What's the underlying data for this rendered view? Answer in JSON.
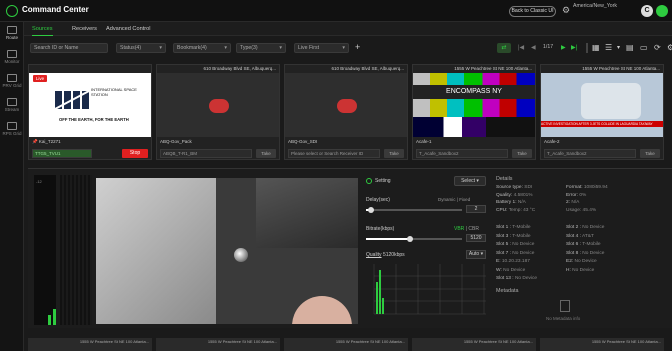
{
  "header": {
    "app_title": "Command Center",
    "back_button": "Back to Classic UI",
    "timezone": "America/New_York",
    "time": "",
    "avatar_letter": "C"
  },
  "nav": [
    {
      "label": "Route"
    },
    {
      "label": "Monitor"
    },
    {
      "label": "PRV Grid"
    },
    {
      "label": "Stream"
    },
    {
      "label": "RPS Grid"
    }
  ],
  "tabs": [
    "Sources",
    "Receivers",
    "Advanced Control"
  ],
  "filters": {
    "search_placeholder": "Search ID or Name",
    "status": "Status(4)",
    "bookmark": "Bookmark(4)",
    "type": "Type(3)",
    "sort": "Live First",
    "pagination": "1/17"
  },
  "tiles": [
    {
      "address": "",
      "name": "Kai_T2271",
      "source": "TTG5_TVU1",
      "action": "Stop",
      "live": "Live",
      "iss_title": "INTERNATIONAL SPACE STATION",
      "iss_sub": "OFF THE EARTH, FOR THE EARTH"
    },
    {
      "address": "610 Broadway Blvd SE, Albuquerq...",
      "name": "ABQ-Gov_Pack",
      "source": "ABQB_T-R1_BM",
      "action": "Take"
    },
    {
      "address": "610 Broadway Blvd SE, Albuquerq...",
      "name": "ABQ-Gov_SDI",
      "source": "Please select or Search Receiver ID",
      "action": "Take"
    },
    {
      "address": "1555 W Peachtree St NE 100 Atlanta...",
      "name": "Acafe-1",
      "source": "T_Acafe_Sandbox2",
      "action": "Take",
      "overlay": "ENCOMPASS NY"
    },
    {
      "address": "1555 W Peachtree St NE 100 Atlanta...",
      "name": "Acafe-2",
      "source": "T_Acafe_Sandbox2",
      "action": "Take",
      "ticker": "ACTIVE INVESTIGATION AFTER 3 JETS COLLIDE IN LAGUARDIA TAXIWAY"
    }
  ],
  "settings": {
    "setting_label": "Setting",
    "select_label": "Select",
    "delay_label": "Delay(sec)",
    "dynamic_label": "Dynamic",
    "fixed_label": "Fixed",
    "delay_value": "2",
    "bitrate_label": "Bitrate(kbps)",
    "vbr": "VBR",
    "cbr": "CBR",
    "bitrate_value": "5120",
    "quality_label": "Quality",
    "quality_value": "5120kbps",
    "auto_label": "Auto"
  },
  "details": {
    "title": "Details",
    "left": [
      {
        "k": "Source type:",
        "v": "SDI"
      },
      {
        "k": "Quality:",
        "v": "4.5801%"
      },
      {
        "k": "Battery 1:",
        "v": "N/A"
      },
      {
        "k": "CPU:",
        "v": "Temp: 43 °C"
      }
    ],
    "right": [
      {
        "k": "Format:",
        "v": "1080i59.94"
      },
      {
        "k": "Error:",
        "v": "0%"
      },
      {
        "k": "2:",
        "v": "N/A"
      },
      {
        "k": "",
        "v": "Usage: 45.4%"
      }
    ],
    "slots_left": [
      {
        "k": "Slot 1 :",
        "v": "T-Mobile"
      },
      {
        "k": "Slot 3 :",
        "v": "T-Mobile"
      },
      {
        "k": "Slot 5 :",
        "v": "No Device"
      },
      {
        "k": "Slot 7 :",
        "v": "No Device"
      },
      {
        "k": "E:",
        "v": "10.20.23.187"
      },
      {
        "k": "W:",
        "v": "No Device"
      },
      {
        "k": "Slot 13 :",
        "v": "No Device"
      }
    ],
    "slots_right": [
      {
        "k": "Slot 2 :",
        "v": "No Device"
      },
      {
        "k": "Slot 4 :",
        "v": "AT&T"
      },
      {
        "k": "Slot 6 :",
        "v": "T-Mobile"
      },
      {
        "k": "Slot 8 :",
        "v": "No Device"
      },
      {
        "k": "E2:",
        "v": "No Device"
      },
      {
        "k": "H:",
        "v": "No Device"
      },
      {
        "k": "",
        "v": ""
      }
    ],
    "metadata_title": "Metadata",
    "metadata_empty": "No Metadata info"
  },
  "bottom_tiles": [
    "1555 W Peachtree St NE 100 Atlanta...",
    "1555 W Peachtree St NE 100 Atlanta...",
    "1555 W Peachtree St NE 100 Atlanta...",
    "1555 W Peachtree St NE 100 Atlanta...",
    "1555 W Peachtree St NE 100 Atlanta..."
  ],
  "colors": {
    "accent": "#2ecc40",
    "stop": "#e02020"
  }
}
